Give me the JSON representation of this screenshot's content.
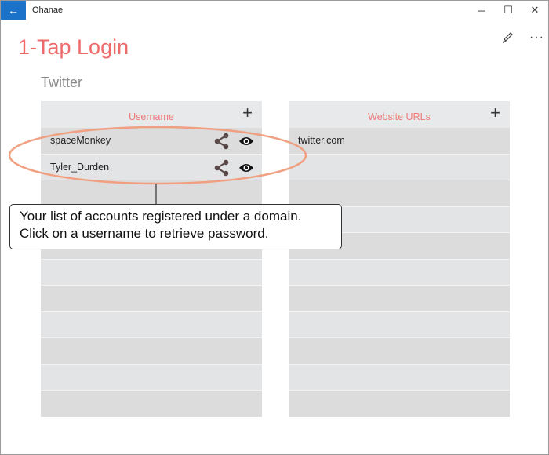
{
  "window": {
    "app_title": "Ohanae",
    "controls": {
      "minimize": "─",
      "maximize": "☐",
      "close": "✕"
    }
  },
  "header": {
    "title": "1-Tap Login",
    "more_label": "···"
  },
  "domain": {
    "name": "Twitter"
  },
  "usernames_panel": {
    "header": "Username",
    "add_label": "+",
    "rows": [
      "spaceMonkey",
      "Tyler_Durden",
      "",
      "",
      "",
      "",
      "",
      "",
      "",
      "",
      ""
    ]
  },
  "urls_panel": {
    "header": "Website URLs",
    "add_label": "+",
    "rows": [
      "twitter.com",
      "",
      "",
      "",
      "",
      "",
      "",
      "",
      "",
      "",
      ""
    ]
  },
  "callout": {
    "line1": "Your list of accounts registered under a domain.",
    "line2": "Click on a username to retrieve password."
  },
  "colors": {
    "accent": "#ee6b6b",
    "back_button": "#1a73c8",
    "annotation_ellipse": "#f0a080"
  },
  "icons": [
    "back-arrow-icon",
    "pencil-icon",
    "more-icon",
    "plus-icon",
    "share-icon",
    "eye-icon"
  ]
}
